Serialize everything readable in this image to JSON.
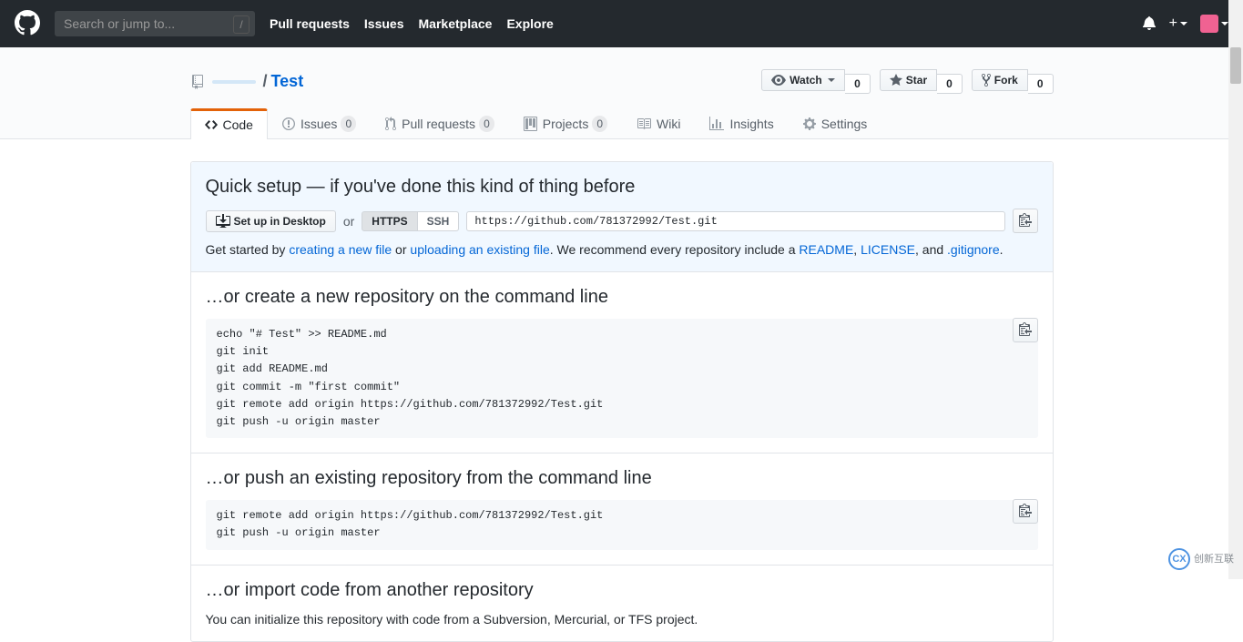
{
  "header": {
    "search_placeholder": "Search or jump to...",
    "nav": [
      "Pull requests",
      "Issues",
      "Marketplace",
      "Explore"
    ]
  },
  "repo": {
    "owner_hidden": "",
    "separator": "/",
    "name": "Test"
  },
  "pagehead_actions": {
    "watch": {
      "label": "Watch",
      "count": "0"
    },
    "star": {
      "label": "Star",
      "count": "0"
    },
    "fork": {
      "label": "Fork",
      "count": "0"
    }
  },
  "tabs": {
    "code": {
      "label": "Code"
    },
    "issues": {
      "label": "Issues",
      "count": "0"
    },
    "pulls": {
      "label": "Pull requests",
      "count": "0"
    },
    "projects": {
      "label": "Projects",
      "count": "0"
    },
    "wiki": {
      "label": "Wiki"
    },
    "insights": {
      "label": "Insights"
    },
    "settings": {
      "label": "Settings"
    }
  },
  "quick_setup": {
    "title": "Quick setup — if you've done this kind of thing before",
    "desktop_btn": "Set up in Desktop",
    "or": "or",
    "https": "HTTPS",
    "ssh": "SSH",
    "clone_url": "https://github.com/781372992/Test.git",
    "hint_prefix": "Get started by ",
    "new_file": "creating a new file",
    "hint_or": " or ",
    "upload_file": "uploading an existing file",
    "hint_suffix": ". We recommend every repository include a ",
    "readme": "README",
    "comma1": ", ",
    "license": "LICENSE",
    "and": ", and ",
    "gitignore": ".gitignore",
    "period": "."
  },
  "create_section": {
    "title": "…or create a new repository on the command line",
    "code": "echo \"# Test\" >> README.md\ngit init\ngit add README.md\ngit commit -m \"first commit\"\ngit remote add origin https://github.com/781372992/Test.git\ngit push -u origin master"
  },
  "push_section": {
    "title": "…or push an existing repository from the command line",
    "code": "git remote add origin https://github.com/781372992/Test.git\ngit push -u origin master"
  },
  "import_section": {
    "title": "…or import code from another repository",
    "desc": "You can initialize this repository with code from a Subversion, Mercurial, or TFS project."
  },
  "watermark": {
    "text": "创新互联"
  }
}
